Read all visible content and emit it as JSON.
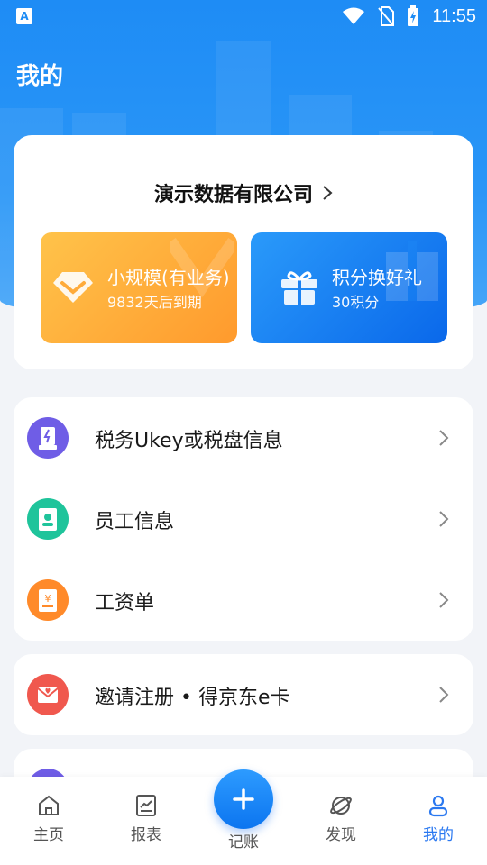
{
  "status_bar": {
    "time": "11:55"
  },
  "header": {
    "title": "我的"
  },
  "company": {
    "name": "演示数据有限公司"
  },
  "plan_tile": {
    "title": "小规模(有业务)",
    "subtitle": "9832天后到期"
  },
  "points_tile": {
    "title": "积分换好礼",
    "subtitle": "30积分"
  },
  "menu": {
    "items": [
      {
        "label": "税务Ukey或税盘信息",
        "icon": "ukey-icon",
        "color": "#6f5de6"
      },
      {
        "label": "员工信息",
        "icon": "employee-badge-icon",
        "color": "#1fc49b"
      },
      {
        "label": "工资单",
        "icon": "payslip-icon",
        "color": "#ff8a2a"
      }
    ],
    "invite": {
      "label": "邀请注册 • 得京东e卡",
      "icon": "invite-envelope-icon",
      "color": "#f0584e"
    }
  },
  "tabbar": {
    "items": [
      {
        "label": "主页",
        "icon": "home-icon"
      },
      {
        "label": "报表",
        "icon": "report-icon"
      },
      {
        "label": "记账",
        "icon": "plus-icon"
      },
      {
        "label": "发现",
        "icon": "discover-planet-icon"
      },
      {
        "label": "我的",
        "icon": "profile-icon",
        "active": true
      }
    ]
  },
  "colors": {
    "primary": "#1e8cf5",
    "active_tab": "#2a78f0",
    "plan_orange": "#ff9a2d",
    "points_blue": "#0a68ea"
  }
}
